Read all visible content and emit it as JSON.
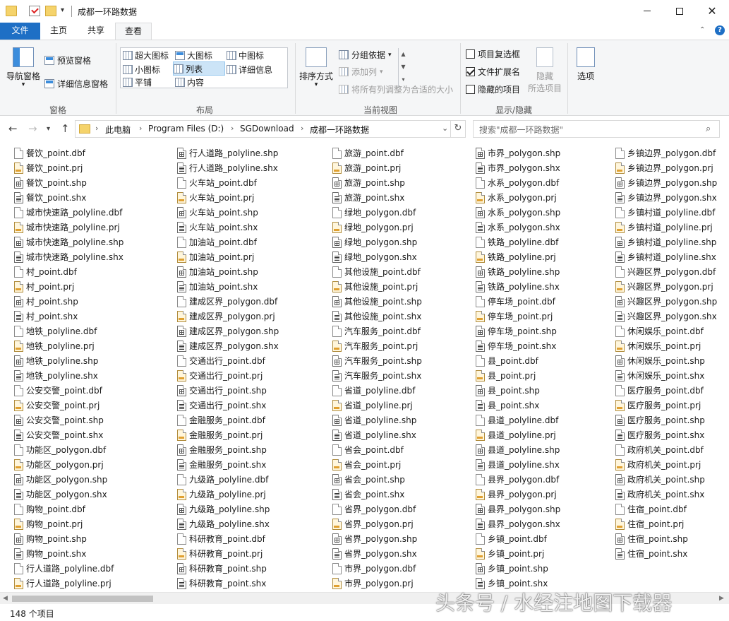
{
  "window": {
    "title": "成都一环路数据",
    "minimize_icon": "minimize-icon",
    "maximize_icon": "maximize-icon",
    "close_icon": "close-icon"
  },
  "ribbon_tabs": [
    "文件",
    "主页",
    "共享",
    "查看"
  ],
  "ribbon": {
    "panes": {
      "label": "窗格",
      "nav_pane": "导航窗格",
      "preview_pane": "预览窗格",
      "details_pane": "详细信息窗格"
    },
    "layout": {
      "label": "布局",
      "items": [
        "超大图标",
        "大图标",
        "中图标",
        "小图标",
        "列表",
        "详细信息",
        "平铺",
        "内容"
      ],
      "selected": "列表"
    },
    "current_view": {
      "label": "当前视图",
      "sort_by": "排序方式",
      "group_by": "分组依据",
      "add_columns": "添加列",
      "fit_columns": "将所有列调整为合适的大小"
    },
    "show_hide": {
      "label": "显示/隐藏",
      "item_checkboxes": "项目复选框",
      "item_checkboxes_checked": false,
      "file_extensions": "文件扩展名",
      "file_extensions_checked": true,
      "hidden_items": "隐藏的项目",
      "hidden_items_checked": false,
      "hide_selected": "隐藏",
      "hide_selected_sub": "所选项目"
    },
    "options": "选项"
  },
  "address": {
    "crumbs": [
      "此电脑",
      "Program Files (D:)",
      "SGDownload",
      "成都一环路数据"
    ],
    "search_placeholder": "搜索\"成都一环路数据\""
  },
  "files": {
    "columns": [
      [
        "餐饮_point.dbf",
        "餐饮_point.prj",
        "餐饮_point.shp",
        "餐饮_point.shx",
        "城市快速路_polyline.dbf",
        "城市快速路_polyline.prj",
        "城市快速路_polyline.shp",
        "城市快速路_polyline.shx",
        "村_point.dbf",
        "村_point.prj",
        "村_point.shp",
        "村_point.shx",
        "地铁_polyline.dbf",
        "地铁_polyline.prj",
        "地铁_polyline.shp",
        "地铁_polyline.shx",
        "公安交警_point.dbf",
        "公安交警_point.prj",
        "公安交警_point.shp",
        "公安交警_point.shx",
        "功能区_polygon.dbf",
        "功能区_polygon.prj",
        "功能区_polygon.shp",
        "功能区_polygon.shx",
        "购物_point.dbf",
        "购物_point.prj",
        "购物_point.shp",
        "购物_point.shx",
        "行人道路_polyline.dbf",
        "行人道路_polyline.prj"
      ],
      [
        "行人道路_polyline.shp",
        "行人道路_polyline.shx",
        "火车站_point.dbf",
        "火车站_point.prj",
        "火车站_point.shp",
        "火车站_point.shx",
        "加油站_point.dbf",
        "加油站_point.prj",
        "加油站_point.shp",
        "加油站_point.shx",
        "建成区界_polygon.dbf",
        "建成区界_polygon.prj",
        "建成区界_polygon.shp",
        "建成区界_polygon.shx",
        "交通出行_point.dbf",
        "交通出行_point.prj",
        "交通出行_point.shp",
        "交通出行_point.shx",
        "金融服务_point.dbf",
        "金融服务_point.prj",
        "金融服务_point.shp",
        "金融服务_point.shx",
        "九级路_polyline.dbf",
        "九级路_polyline.prj",
        "九级路_polyline.shp",
        "九级路_polyline.shx",
        "科研教育_point.dbf",
        "科研教育_point.prj",
        "科研教育_point.shp",
        "科研教育_point.shx"
      ],
      [
        "旅游_point.dbf",
        "旅游_point.prj",
        "旅游_point.shp",
        "旅游_point.shx",
        "绿地_polygon.dbf",
        "绿地_polygon.prj",
        "绿地_polygon.shp",
        "绿地_polygon.shx",
        "其他设施_point.dbf",
        "其他设施_point.prj",
        "其他设施_point.shp",
        "其他设施_point.shx",
        "汽车服务_point.dbf",
        "汽车服务_point.prj",
        "汽车服务_point.shp",
        "汽车服务_point.shx",
        "省道_polyline.dbf",
        "省道_polyline.prj",
        "省道_polyline.shp",
        "省道_polyline.shx",
        "省会_point.dbf",
        "省会_point.prj",
        "省会_point.shp",
        "省会_point.shx",
        "省界_polygon.dbf",
        "省界_polygon.prj",
        "省界_polygon.shp",
        "省界_polygon.shx",
        "市界_polygon.dbf",
        "市界_polygon.prj"
      ],
      [
        "市界_polygon.shp",
        "市界_polygon.shx",
        "水系_polygon.dbf",
        "水系_polygon.prj",
        "水系_polygon.shp",
        "水系_polygon.shx",
        "铁路_polyline.dbf",
        "铁路_polyline.prj",
        "铁路_polyline.shp",
        "铁路_polyline.shx",
        "停车场_point.dbf",
        "停车场_point.prj",
        "停车场_point.shp",
        "停车场_point.shx",
        "县_point.dbf",
        "县_point.prj",
        "县_point.shp",
        "县_point.shx",
        "县道_polyline.dbf",
        "县道_polyline.prj",
        "县道_polyline.shp",
        "县道_polyline.shx",
        "县界_polygon.dbf",
        "县界_polygon.prj",
        "县界_polygon.shp",
        "县界_polygon.shx",
        "乡镇_point.dbf",
        "乡镇_point.prj",
        "乡镇_point.shp",
        "乡镇_point.shx"
      ],
      [
        "乡镇边界_polygon.dbf",
        "乡镇边界_polygon.prj",
        "乡镇边界_polygon.shp",
        "乡镇边界_polygon.shx",
        "乡镇村道_polyline.dbf",
        "乡镇村道_polyline.prj",
        "乡镇村道_polyline.shp",
        "乡镇村道_polyline.shx",
        "兴趣区界_polygon.dbf",
        "兴趣区界_polygon.prj",
        "兴趣区界_polygon.shp",
        "兴趣区界_polygon.shx",
        "休闲娱乐_point.dbf",
        "休闲娱乐_point.prj",
        "休闲娱乐_point.shp",
        "休闲娱乐_point.shx",
        "医疗服务_point.dbf",
        "医疗服务_point.prj",
        "医疗服务_point.shp",
        "医疗服务_point.shx",
        "政府机关_point.dbf",
        "政府机关_point.prj",
        "政府机关_point.shp",
        "政府机关_point.shx",
        "住宿_point.dbf",
        "住宿_point.prj",
        "住宿_point.shp",
        "住宿_point.shx"
      ]
    ]
  },
  "status": {
    "item_count": "148 个项目"
  },
  "watermark": "头条号 / 水经注地图下载器"
}
